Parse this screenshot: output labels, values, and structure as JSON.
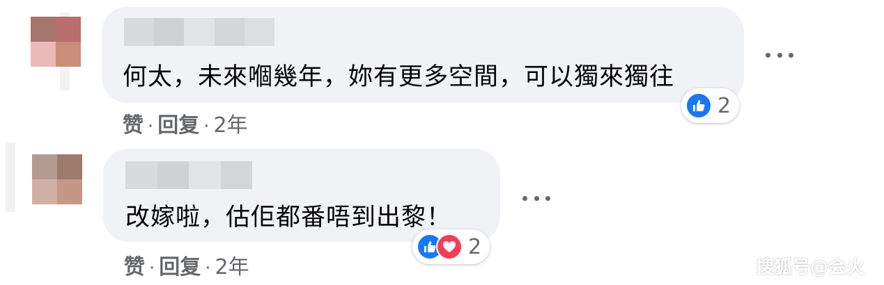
{
  "comments": [
    {
      "text": "何太，未來嗰幾年，妳有更多空間，可以獨來獨往",
      "like_label": "赞",
      "reply_label": "回复",
      "separator": "·",
      "time": "2年",
      "reaction_icons": [
        "like-icon"
      ],
      "reaction_count": "2",
      "avatar_colors": [
        "#a5776c",
        "#b86e6e",
        "#ebb9b7",
        "#c98d7a"
      ]
    },
    {
      "text": "改嫁啦，估佢都番唔到出黎！",
      "like_label": "赞",
      "reply_label": "回复",
      "separator": "·",
      "time": "2年",
      "reaction_icons": [
        "like-icon",
        "love-icon"
      ],
      "reaction_count": "2",
      "avatar_colors": [
        "#b49a90",
        "#9c7a6c",
        "#d0b0a4",
        "#c49787"
      ]
    }
  ],
  "watermark": "搜狐号@会火",
  "colors": {
    "bubble": "#f0f2f5",
    "text": "#050505",
    "meta": "#65676b",
    "like": "#1877f2",
    "love": "#f33e58"
  }
}
